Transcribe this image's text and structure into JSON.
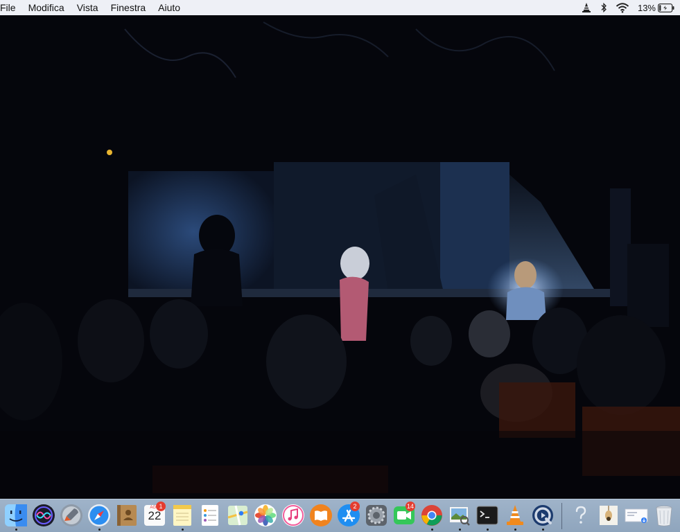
{
  "menubar": {
    "items": [
      {
        "label": "File"
      },
      {
        "label": "Modifica"
      },
      {
        "label": "Vista"
      },
      {
        "label": "Finestra"
      },
      {
        "label": "Aiuto"
      }
    ],
    "status": {
      "icons": [
        "vlc-cone-icon",
        "bluetooth-icon",
        "wifi-icon"
      ],
      "battery_text": "13%",
      "battery_icon": "battery-charging-icon",
      "battery_level": 0.13
    }
  },
  "desktop": {
    "wallpaper": "dark theatre stage photo"
  },
  "dock": {
    "apps": [
      {
        "icon": "finder-icon",
        "running": true
      },
      {
        "icon": "siri-icon",
        "running": false
      },
      {
        "icon": "launchpad-icon",
        "running": false
      },
      {
        "icon": "safari-icon",
        "running": true
      },
      {
        "icon": "contacts-icon",
        "running": false
      },
      {
        "icon": "calendar-icon",
        "running": false,
        "badge": "1",
        "month": "AGO",
        "day": "22"
      },
      {
        "icon": "notes-icon",
        "running": true
      },
      {
        "icon": "reminders-icon",
        "running": false
      },
      {
        "icon": "maps-icon",
        "running": false
      },
      {
        "icon": "photos-icon",
        "running": false
      },
      {
        "icon": "itunes-icon",
        "running": false
      },
      {
        "icon": "ibooks-icon",
        "running": false
      },
      {
        "icon": "app-store-icon",
        "running": false,
        "badge": "2"
      },
      {
        "icon": "system-preferences-icon",
        "running": false
      },
      {
        "icon": "facetime-icon",
        "running": false,
        "badge": "14"
      },
      {
        "icon": "chrome-icon",
        "running": true
      },
      {
        "icon": "preview-icon",
        "running": true
      },
      {
        "icon": "terminal-icon",
        "running": true
      },
      {
        "icon": "vlc-icon",
        "running": true
      },
      {
        "icon": "quicktime-icon",
        "running": true
      }
    ],
    "right_items": [
      {
        "icon": "help-question-icon"
      },
      {
        "icon": "document-stack-icon"
      },
      {
        "icon": "downloads-stack-icon"
      },
      {
        "icon": "trash-icon"
      }
    ]
  },
  "colors": {
    "menubar_bg": "#eef0f6",
    "dock_bg": "#9fb3c9",
    "badge": "#e43c2f"
  }
}
